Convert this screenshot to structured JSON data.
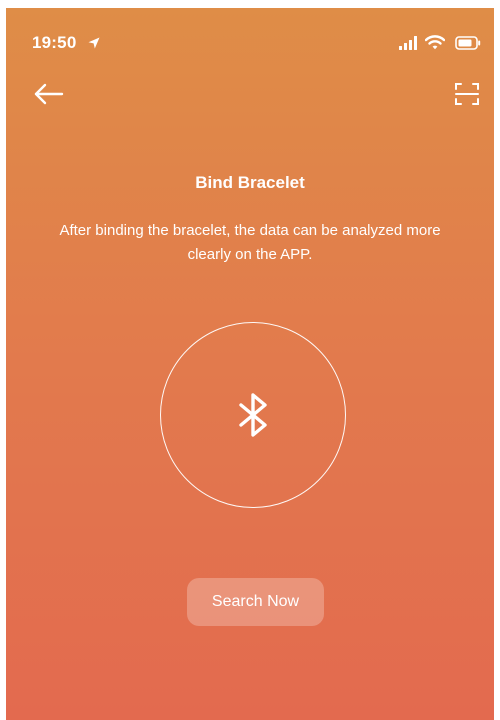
{
  "status_bar": {
    "time": "19:50",
    "icons": [
      "location-arrow-icon",
      "cellular-signal-icon",
      "wifi-icon",
      "battery-icon"
    ]
  },
  "nav": {
    "back_icon": "back-arrow-icon",
    "scan_icon": "scan-icon"
  },
  "main": {
    "title": "Bind Bracelet",
    "description": "After binding the bracelet, the data can be analyzed more clearly on the APP.",
    "bluetooth_icon": "bluetooth-icon",
    "search_button_label": "Search Now"
  },
  "colors": {
    "gradient_top": "#DF8D47",
    "gradient_bottom": "#E36A4F",
    "text": "#FFFFFF"
  }
}
